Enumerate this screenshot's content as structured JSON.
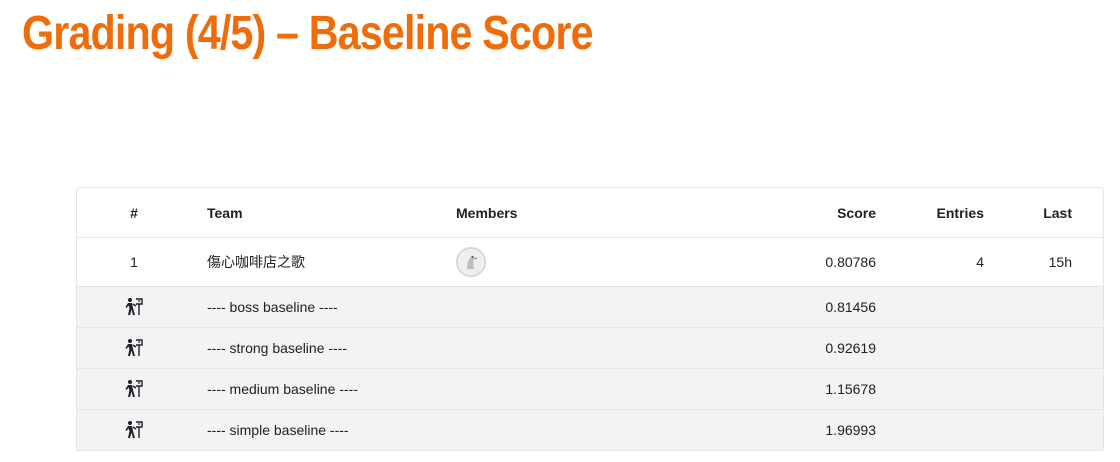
{
  "title": "Grading (4/5) – Baseline Score",
  "columns": {
    "rank": "#",
    "team": "Team",
    "members": "Members",
    "score": "Score",
    "entries": "Entries",
    "last": "Last"
  },
  "entries": [
    {
      "rank": "1",
      "team": "傷心咖啡店之歌",
      "member_icon": "user-avatar-icon",
      "score": "0.80786",
      "entries": "4",
      "last": "15h"
    }
  ],
  "baselines": [
    {
      "icon": "hiker-icon",
      "label": "---- boss baseline ----",
      "score": "0.81456"
    },
    {
      "icon": "hiker-icon",
      "label": "---- strong baseline ----",
      "score": "0.92619"
    },
    {
      "icon": "hiker-icon",
      "label": "---- medium baseline ----",
      "score": "1.15678"
    },
    {
      "icon": "hiker-icon",
      "label": "---- simple baseline ----",
      "score": "1.96993"
    }
  ],
  "colors": {
    "title": "#ee6c0a",
    "baseline_row_bg": "#f1f3f4",
    "border": "#e4e5e7",
    "text": "#202124"
  }
}
